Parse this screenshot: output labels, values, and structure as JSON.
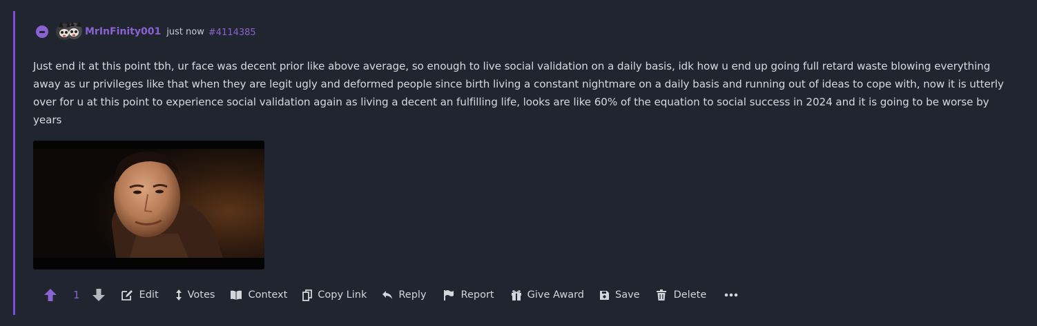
{
  "comment": {
    "username": "MrInFinity001",
    "time": "just now",
    "post_id": "#4114385",
    "text": "Just end it at this point tbh, ur face was decent prior like above average, so enough to live social validation on a daily basis, idk how u end up going full retard waste blowing everything away as ur privileges like that when they are legit ugly and deformed people since birth living a constant nightmare on a daily basis and running out of ideas to cope with, now it is utterly over for u at this point to experience social validation again as living a decent an fulfilling life, looks are like 60% of the equation to social success in 2024 and it is going to be worse by years",
    "vote_count": "1"
  },
  "actions": {
    "edit": "Edit",
    "votes": "Votes",
    "context": "Context",
    "copy_link": "Copy Link",
    "reply": "Reply",
    "report": "Report",
    "give_award": "Give Award",
    "save": "Save",
    "delete": "Delete"
  },
  "icons": {
    "collapse": "minus-circle-icon",
    "upvote": "arrow-up-icon",
    "downvote": "arrow-down-icon",
    "edit": "edit-icon",
    "votes": "arrows-up-down-icon",
    "context": "book-open-icon",
    "copy_link": "copy-icon",
    "reply": "reply-icon",
    "report": "flag-icon",
    "give_award": "gift-icon",
    "save": "save-icon",
    "delete": "trash-icon",
    "more": "ellipsis-icon"
  },
  "colors": {
    "background": "#21252f",
    "accent": "#8a63d2",
    "text": "#d7d9de",
    "border": "#7c4dd8"
  }
}
